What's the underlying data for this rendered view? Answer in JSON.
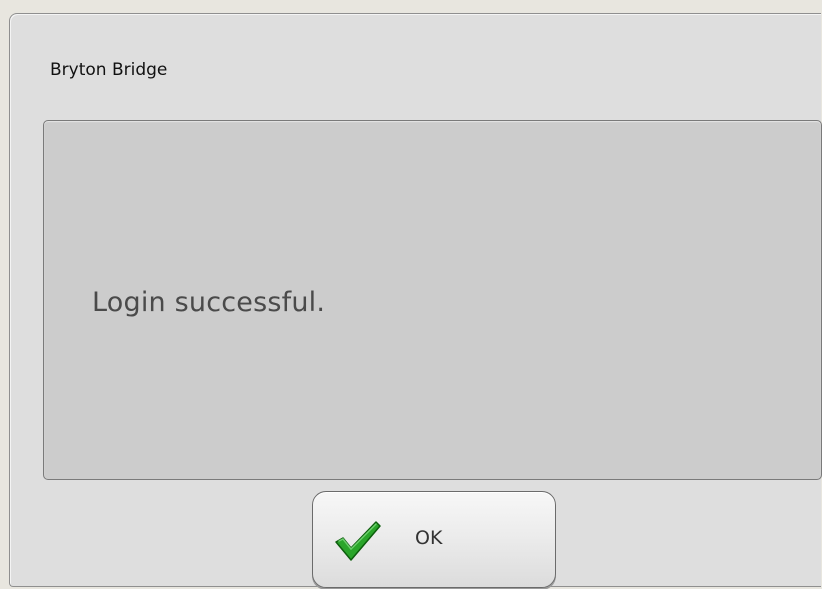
{
  "dialog": {
    "title": "Bryton Bridge",
    "message": "Login successful.",
    "ok_button": {
      "label": "OK",
      "icon": "checkmark-icon"
    }
  },
  "colors": {
    "dialog_background": "#dedede",
    "panel_background": "#cccccc",
    "checkmark_green": "#1f9a1f"
  }
}
